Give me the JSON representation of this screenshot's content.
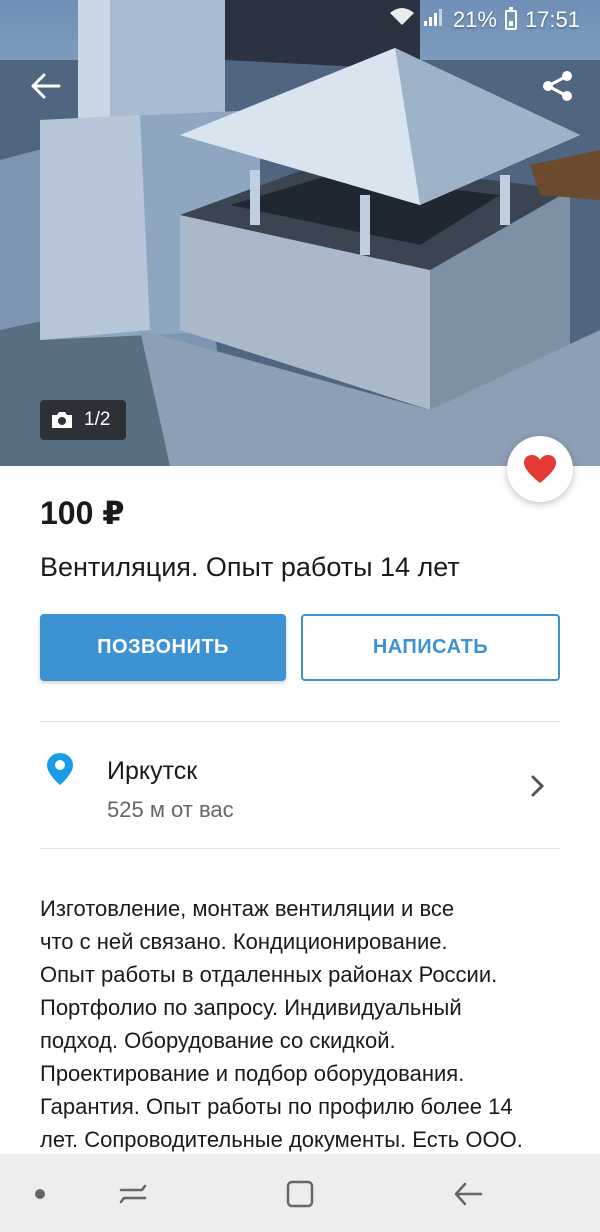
{
  "status_bar": {
    "battery": "21%",
    "time": "17:51"
  },
  "photo": {
    "counter": "1/2"
  },
  "listing": {
    "price": "100 ₽",
    "title": "Вентиляция. Опыт работы 14 лет",
    "call_label": "ПОЗВОНИТЬ",
    "write_label": "НАПИСАТЬ"
  },
  "location": {
    "city": "Иркутск",
    "distance": "525 м от вас"
  },
  "description": {
    "lines": [
      "Изготовление, монтаж вентиляции и все",
      "что с ней связано. Кондиционирование.",
      "Опыт работы в отдаленных районах России.",
      "Портфолио по запросу. Индивидуальный",
      "подход. Оборудование со скидкой.",
      "Проектирование и подбор оборудования.",
      "Гарантия. Опыт работы по профилю более 14",
      "лет. Сопроводительные документы. Есть ООО."
    ]
  },
  "icons": {
    "back": "arrow-left-icon",
    "share": "share-icon",
    "camera": "camera-icon",
    "favorite": "heart-icon",
    "location": "location-pin-icon",
    "chevron": "chevron-right-icon"
  },
  "colors": {
    "accent": "#3d92d4",
    "favorite": "#e53935",
    "pin": "#1a9be6"
  }
}
